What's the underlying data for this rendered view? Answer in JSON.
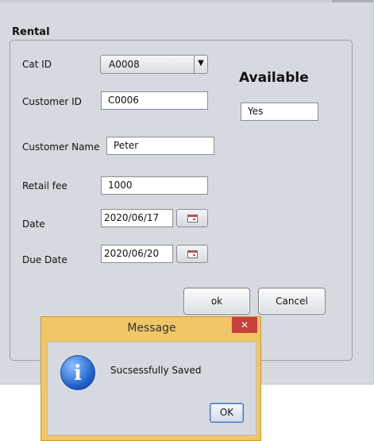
{
  "form": {
    "title": "Rental",
    "cat_id_label": "Cat ID",
    "cat_id_value": "A0008",
    "customer_id_label": "Customer ID",
    "customer_id_value": "C0006",
    "customer_name_label": "Customer Name",
    "customer_name_value": "Peter",
    "retail_fee_label": "Retail fee",
    "retail_fee_value": "1000",
    "date_label": "Date",
    "date_value": "2020/06/17",
    "due_date_label": "Due Date",
    "due_date_value": "2020/06/20",
    "status_heading": "Available",
    "status_value": "Yes",
    "ok_label": "ok",
    "cancel_label": "Cancel"
  },
  "dialog": {
    "title": "Message",
    "close_symbol": "✕",
    "message": "Sucsessfully Saved",
    "ok_label": "OK",
    "icon": "info-icon"
  },
  "colors": {
    "window_bg": "#d6d9df",
    "dialog_frame": "#f0c666",
    "close_button": "#c7403a",
    "info_icon": "#1f5fc9"
  }
}
